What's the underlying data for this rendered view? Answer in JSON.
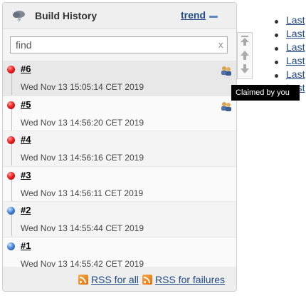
{
  "header": {
    "title": "Build History",
    "trend_label": "trend"
  },
  "filter": {
    "placeholder": "find",
    "clear_label": "x"
  },
  "builds": [
    {
      "number": "#6",
      "date": "Wed Nov 13 15:05:14 CET 2019",
      "status": "failed",
      "claimed": true
    },
    {
      "number": "#5",
      "date": "Wed Nov 13 14:56:20 CET 2019",
      "status": "failed",
      "claimed": true
    },
    {
      "number": "#4",
      "date": "Wed Nov 13 14:56:16 CET 2019",
      "status": "failed",
      "claimed": false
    },
    {
      "number": "#3",
      "date": "Wed Nov 13 14:56:11 CET 2019",
      "status": "failed",
      "claimed": false
    },
    {
      "number": "#2",
      "date": "Wed Nov 13 14:55:44 CET 2019",
      "status": "success",
      "claimed": false
    },
    {
      "number": "#1",
      "date": "Wed Nov 13 14:55:42 CET 2019",
      "status": "success",
      "claimed": false
    }
  ],
  "tooltip": {
    "text": "Claimed by you"
  },
  "footer": {
    "rss_all": "RSS for all",
    "rss_failures": "RSS for failures"
  },
  "right_panel": {
    "items": [
      "Last",
      "Last",
      "Last",
      "Last",
      "Last",
      "Last"
    ]
  },
  "colors": {
    "link": "#204a87",
    "failed": "#e22222",
    "success": "#4a86d8",
    "tooltip_bg": "#000000"
  }
}
